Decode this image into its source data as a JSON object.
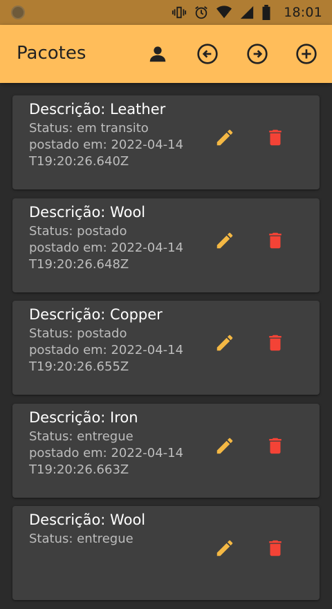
{
  "statusbar": {
    "time": "18:01"
  },
  "appbar": {
    "title": "Pacotes",
    "colors": {
      "background": "#ffbd5a"
    }
  },
  "icons": {
    "account": "account-icon",
    "back": "arrow-left-circle-icon",
    "forward": "arrow-right-circle-icon",
    "add": "plus-circle-icon",
    "edit": "pencil-icon",
    "delete": "trash-icon"
  },
  "packages": [
    {
      "descricao": "Descrição: Leather",
      "status": "Status: em transito",
      "postado": "postado em: 2022-04-14T19:20:26.640Z"
    },
    {
      "descricao": "Descrição: Wool",
      "status": "Status: postado",
      "postado": "postado em: 2022-04-14T19:20:26.648Z"
    },
    {
      "descricao": "Descrição: Copper",
      "status": "Status: postado",
      "postado": "postado em: 2022-04-14T19:20:26.655Z"
    },
    {
      "descricao": "Descrição: Iron",
      "status": "Status: entregue",
      "postado": "postado em: 2022-04-14T19:20:26.663Z"
    },
    {
      "descricao": "Descrição: Wool",
      "status": "Status: entregue",
      "postado": ""
    }
  ],
  "colors": {
    "edit": "#f4b844",
    "delete": "#f44336",
    "card": "#3f3f3f"
  }
}
